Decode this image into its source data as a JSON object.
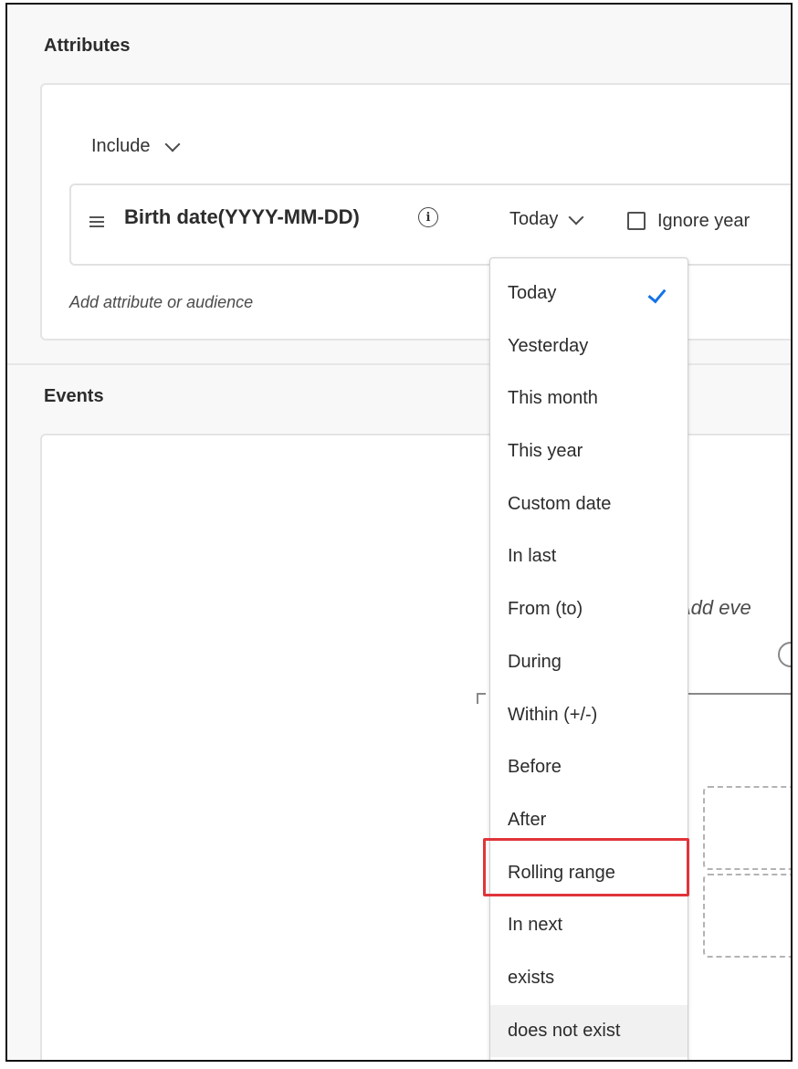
{
  "attributes": {
    "title": "Attributes",
    "include_label": "Include",
    "rule": {
      "field_name": "Birth date(YYYY-MM-DD)",
      "info_icon": "info-icon",
      "operator_value": "Today",
      "ignore_year_label": "Ignore year",
      "ignore_year_checked": false
    },
    "add_label": "Add attribute or audience"
  },
  "events": {
    "title": "Events",
    "add_event_label": "Add eve"
  },
  "dropdown": {
    "selected": "Today",
    "highlighted": "Rolling range",
    "items": [
      "Today",
      "Yesterday",
      "This month",
      "This year",
      "Custom date",
      "In last",
      "From (to)",
      "During",
      "Within (+/-)",
      "Before",
      "After",
      "Rolling range",
      "In next",
      "exists",
      "does not exist"
    ]
  },
  "colors": {
    "accent": "#1473e6",
    "highlight_box": "#e0343a"
  }
}
